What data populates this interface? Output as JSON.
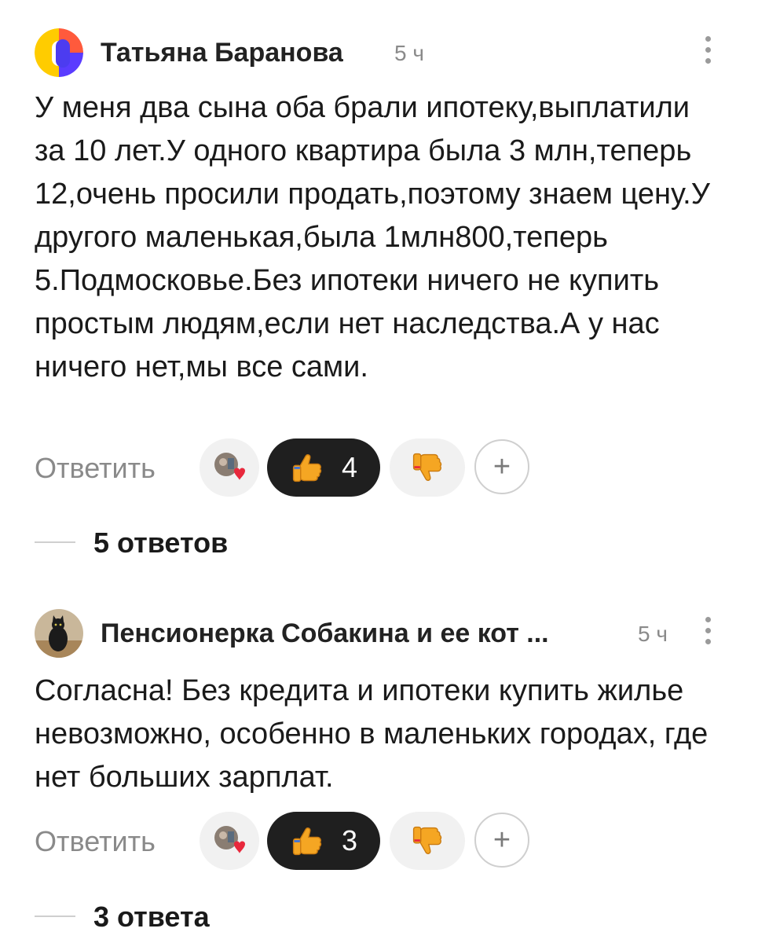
{
  "comments": [
    {
      "author": "Татьяна Баранова",
      "time": "5 ч",
      "text": "У меня два сына оба брали ипотеку,выплатили за 10 лет.У одного квартира была 3 млн,теперь 12,очень просили продать,поэтому знаем цену.У другого маленькая,была 1млн800,теперь 5.Подмосковье.Без ипотеки ничего не купить простым людям,если нет наследства.А у нас ничего нет,мы все сами.",
      "reply_label": "Ответить",
      "likes": "4",
      "add_label": "+",
      "replies_label": "5 ответов"
    },
    {
      "author": "Пенсионерка Собакина и ее кот ...",
      "time": "5 ч",
      "text": "Согласна! Без кредита и ипотеки купить жилье невозможно, особенно в маленьких городах, где нет больших зарплат.",
      "reply_label": "Ответить",
      "likes": "3",
      "add_label": "+",
      "replies_label": "3 ответа"
    }
  ],
  "icons": {
    "more": "more-vertical-icon",
    "like": "thumbs-up-icon",
    "dislike": "thumbs-down-icon",
    "add": "plus-icon",
    "reaction_heart": "heart-icon"
  },
  "colors": {
    "like_pill": "#1f1f1f",
    "pill": "#f1f1f1",
    "muted_text": "#8a8a8a",
    "thumb": "#f5a623",
    "heart": "#e8283c"
  }
}
